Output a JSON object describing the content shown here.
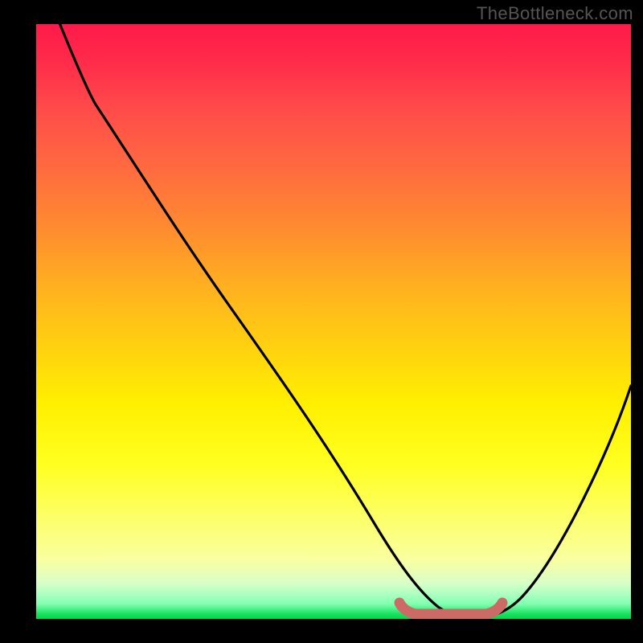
{
  "watermark": "TheBottleneck.com",
  "chart_data": {
    "type": "line",
    "title": "",
    "xlabel": "",
    "ylabel": "",
    "xlim": [
      0,
      100
    ],
    "ylim": [
      0,
      100
    ],
    "grid": false,
    "legend": false,
    "series": [
      {
        "name": "bottleneck-curve",
        "x": [
          4,
          10,
          20,
          30,
          40,
          50,
          58,
          63,
          67,
          72,
          74,
          78,
          84,
          90,
          96,
          100
        ],
        "y": [
          100,
          91,
          78,
          64,
          50,
          36,
          22,
          12,
          5,
          1,
          1,
          1,
          5,
          16,
          30,
          42
        ],
        "color": "#000000"
      },
      {
        "name": "optimal-zone-marker",
        "x": [
          61,
          63,
          67,
          72,
          76,
          78
        ],
        "y": [
          2.5,
          1.2,
          0.8,
          0.8,
          1.2,
          2.5
        ],
        "color": "#cc6a66"
      }
    ],
    "background_gradient": {
      "top_color": "#ff1a4a",
      "mid_color": "#fff000",
      "bottom_color": "#00d848"
    }
  }
}
